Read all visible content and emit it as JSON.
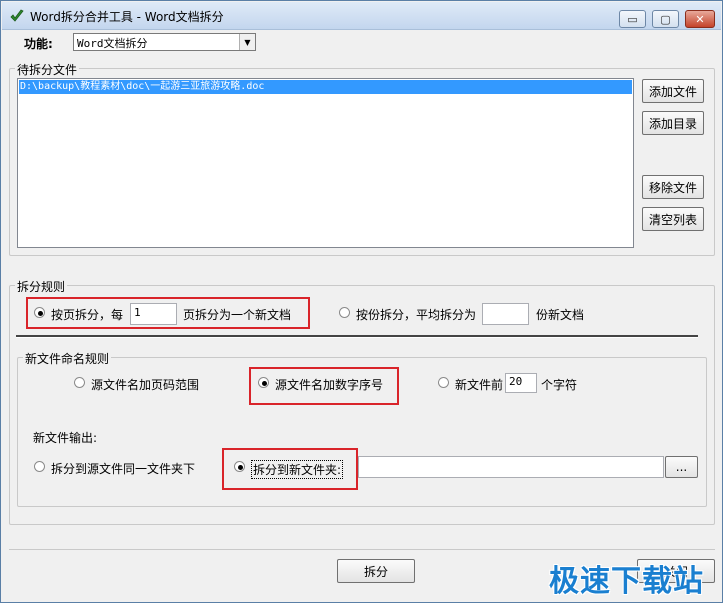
{
  "window": {
    "title": "Word拆分合并工具 - Word文档拆分",
    "min_label": "▭",
    "max_label": "▢",
    "close_label": "✕"
  },
  "function_label": "功能:",
  "function_select": {
    "value": "Word文档拆分"
  },
  "files_group": {
    "title": "待拆分文件",
    "items": [
      "D:\\backup\\教程素材\\doc\\一起游三亚旅游攻略.doc"
    ],
    "add_file": "添加文件",
    "add_dir": "添加目录",
    "remove_file": "移除文件",
    "clear_list": "清空列表"
  },
  "rules_group": {
    "title": "拆分规则",
    "by_page_label": "按页拆分，每",
    "by_page_value": "1",
    "by_page_suffix": "页拆分为一个新文档",
    "by_page_selected": true,
    "by_count_label": "按份拆分，平均拆分为",
    "by_count_value": "",
    "by_count_suffix": "份新文档",
    "by_count_selected": false
  },
  "naming_group": {
    "title": "新文件命名规则",
    "opt1": "源文件名加页码范围",
    "opt2": "源文件名加数字序号",
    "opt3_prefix": "新文件前",
    "opt3_value": "20",
    "opt3_suffix": "个字符",
    "selected": "opt2",
    "output_label": "新文件输出:",
    "out_same": "拆分到源文件同一文件夹下",
    "out_new": "拆分到新文件夹:",
    "out_path": "",
    "browse": "...",
    "out_selected": "out_new"
  },
  "split_button": "拆分",
  "close_button": "关闭",
  "watermark": "极速下载站",
  "colors": {
    "selection": "#3399ff",
    "highlight": "#d9242a",
    "watermark": "#1a7fd0"
  }
}
